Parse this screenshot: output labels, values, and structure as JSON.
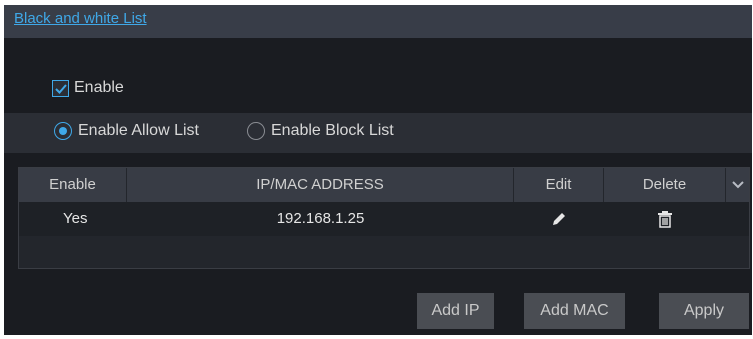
{
  "title": "Black and white List",
  "enable": {
    "label": "Enable",
    "checked": true
  },
  "mode": {
    "allow_label": "Enable Allow List",
    "block_label": "Enable Block List",
    "selected": "allow"
  },
  "table": {
    "headers": {
      "enable": "Enable",
      "address": "IP/MAC ADDRESS",
      "edit": "Edit",
      "delete": "Delete"
    },
    "rows": [
      {
        "enable": "Yes",
        "address": "192.168.1.25"
      }
    ]
  },
  "buttons": {
    "add_ip": "Add IP",
    "add_mac": "Add MAC",
    "apply": "Apply"
  },
  "icons": {
    "checkbox": "check-icon",
    "edit": "pencil-icon",
    "delete": "trash-icon",
    "scroll": "chevron-down-icon"
  },
  "colors": {
    "accent": "#3fa8e8",
    "panel": "#1a1c21",
    "header": "#383d48"
  }
}
